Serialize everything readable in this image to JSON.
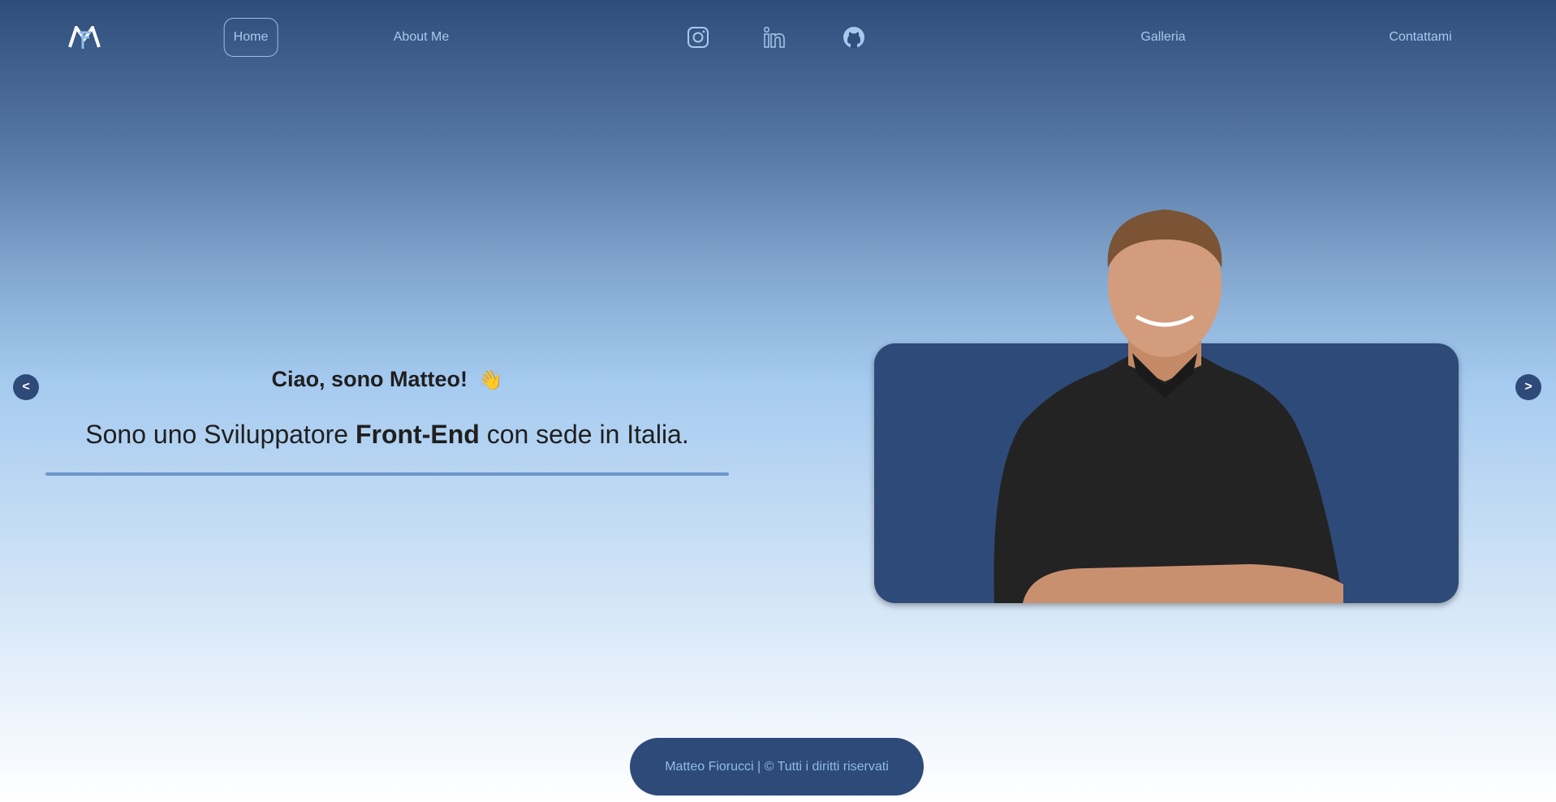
{
  "nav": {
    "logo_text": "MF",
    "home": "Home",
    "about": "About Me",
    "gallery": "Galleria",
    "contact": "Contattami",
    "social": [
      "instagram-icon",
      "linkedin-icon",
      "github-icon"
    ]
  },
  "hero": {
    "greeting": "Ciao, sono Matteo!",
    "wave": "👋",
    "intro_pre": "Sono uno Sviluppatore ",
    "intro_bold": "Front-End",
    "intro_post": " con sede in Italia."
  },
  "carousel": {
    "prev": "<",
    "next": ">"
  },
  "footer": {
    "text": "Matteo Fiorucci | © Tutti i diritti riservati"
  },
  "colors": {
    "accent": "#2e4a78",
    "nav_text": "#a9c8ee",
    "underline": "#6f95cc"
  }
}
